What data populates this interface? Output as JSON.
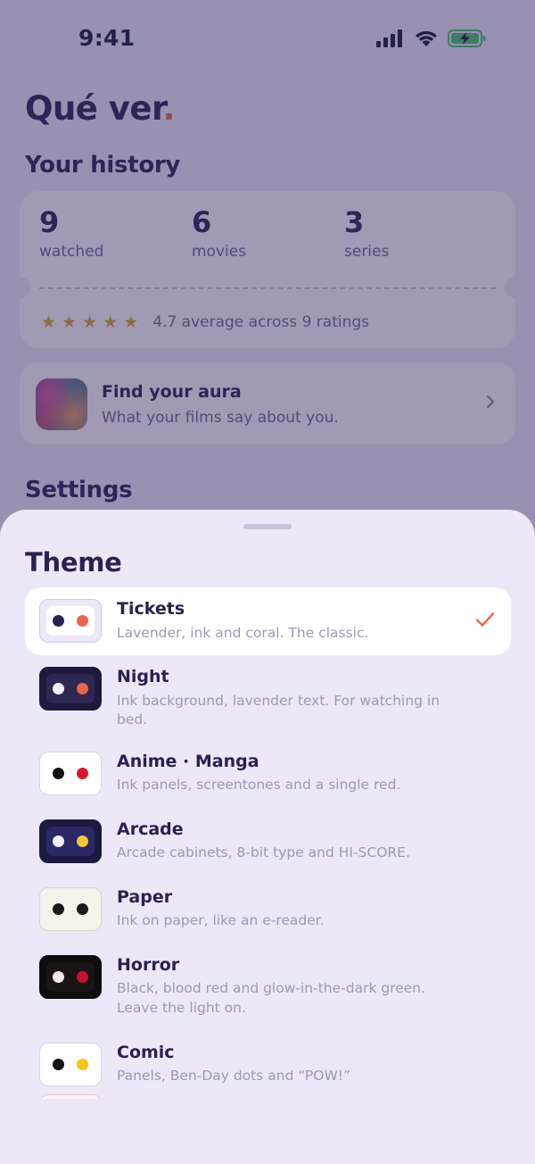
{
  "status_bar": {
    "time": "9:41",
    "icons": [
      "cellular-signal-icon",
      "wifi-icon",
      "battery-charging-icon"
    ]
  },
  "app": {
    "title": "Qué ver",
    "title_dot": ".",
    "accent_color": "#e8664c",
    "ink_color": "#2b2150"
  },
  "history": {
    "heading": "Your history",
    "stats": [
      {
        "value": "9",
        "label": "watched"
      },
      {
        "value": "6",
        "label": "movies"
      },
      {
        "value": "3",
        "label": "series"
      }
    ],
    "stars": 5,
    "rating_text": "4.7 average across 9 ratings"
  },
  "aura": {
    "title": "Find your aura",
    "subtitle": "What your films say about you."
  },
  "settings": {
    "heading": "Settings"
  },
  "theme_sheet": {
    "title": "Theme",
    "selected": "Tickets",
    "themes": [
      {
        "name": "Tickets",
        "description": "Lavender, ink and coral. The classic.",
        "swatch_bg": "#ece8f8",
        "swatch_border": "#cfc8ec",
        "swatch_inner": "#ffffff",
        "dots": [
          "#2b2150",
          "#e8664c"
        ]
      },
      {
        "name": "Night",
        "description": "Ink background, lavender text. For watching in bed.",
        "swatch_bg": "#1f1a3d",
        "swatch_border": "#1f1a3d",
        "swatch_inner": "#2d2752",
        "dots": [
          "#f1eefb",
          "#e8664c"
        ]
      },
      {
        "name": "Anime · Manga",
        "description": "Ink panels, screentones and a single red.",
        "swatch_bg": "#ffffff",
        "swatch_border": "#d8d4e4",
        "swatch_inner": "#ffffff",
        "dots": [
          "#111111",
          "#d8182a"
        ]
      },
      {
        "name": "Arcade",
        "description": "Arcade cabinets, 8-bit type and HI-SCORE.",
        "swatch_bg": "#1d1a42",
        "swatch_border": "#1d1a42",
        "swatch_inner": "#2b2866",
        "dots": [
          "#f4f2ff",
          "#f2c53d"
        ]
      },
      {
        "name": "Paper",
        "description": "Ink on paper, like an e-reader.",
        "swatch_bg": "#f6f3ea",
        "swatch_border": "#d9d5cc",
        "swatch_inner": "#f6f3ea",
        "dots": [
          "#1a1a1a",
          "#1a1a1a"
        ]
      },
      {
        "name": "Horror",
        "description": "Black, blood red and glow-in-the-dark green. Leave the light on.",
        "swatch_bg": "#0d0d0d",
        "swatch_border": "#0d0d0d",
        "swatch_inner": "#1a1414",
        "dots": [
          "#f3e6e6",
          "#c8102e"
        ]
      },
      {
        "name": "Comic",
        "description": "Panels, Ben-Day dots and “POW!”",
        "swatch_bg": "#ffffff",
        "swatch_border": "#d8d4e4",
        "swatch_inner": "#ffffff",
        "dots": [
          "#111111",
          "#f5c518"
        ]
      }
    ]
  }
}
